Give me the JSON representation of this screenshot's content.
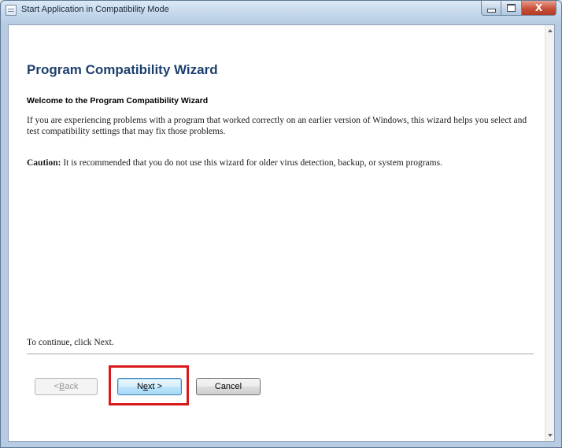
{
  "window": {
    "title": "Start Application in Compatibility Mode",
    "close_glyph": "X"
  },
  "wizard": {
    "title": "Program Compatibility Wizard",
    "subtitle": "Welcome to the Program Compatibility Wizard",
    "description": "If you are experiencing problems with a program that worked correctly on an earlier version of Windows, this wizard helps you select and test compatibility settings that may fix those problems.",
    "caution_label": "Caution:",
    "caution_text": " It is recommended that you do not use this wizard for older virus detection, backup, or system programs.",
    "continue_text": "To continue, click Next."
  },
  "buttons": {
    "back_prefix": "< ",
    "back_mnemonic": "B",
    "back_rest": "ack",
    "next_prefix": "N",
    "next_mnemonic": "e",
    "next_rest": "xt >",
    "cancel": "Cancel"
  },
  "colors": {
    "highlight": "#d9191c",
    "title": "#1d3f6e"
  },
  "icons": [
    "app-icon",
    "minimize-icon",
    "maximize-icon",
    "close-icon",
    "scroll-up-arrow-icon",
    "scroll-down-arrow-icon"
  ]
}
